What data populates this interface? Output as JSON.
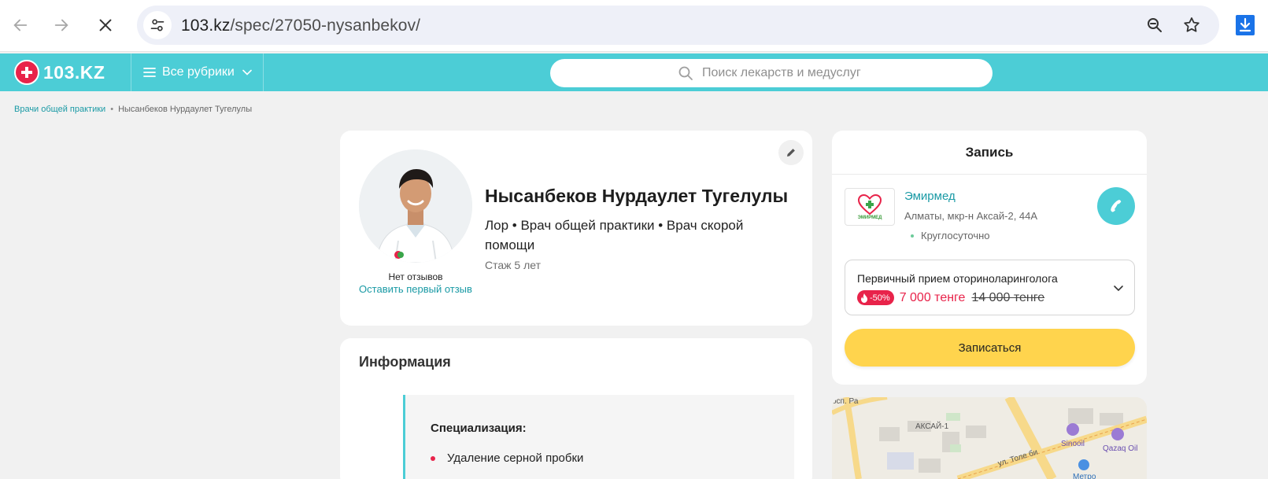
{
  "browser": {
    "url_host": "103.kz",
    "url_path": "/spec/27050-nysanbekov/"
  },
  "site": {
    "logo_text": "103.KZ",
    "rubrics_label": "Все рубрики",
    "search_placeholder": "Поиск лекарств и медуслуг"
  },
  "breadcrumb": {
    "parent": "Врачи общей практики",
    "separator": "•",
    "current": "Нысанбеков Нурдаулет Тугелулы"
  },
  "profile": {
    "name": "Нысанбеков Нурдаулет Тугелулы",
    "specialties": "Лор • Врач общей практики • Врач скорой помощи",
    "experience": "Стаж 5 лет",
    "reviews_none": "Нет отзывов",
    "leave_review": "Оставить первый отзыв"
  },
  "info": {
    "title": "Информация",
    "spec_heading": "Специализация:",
    "spec_items": [
      "Удаление серной пробки"
    ]
  },
  "booking": {
    "title": "Запись",
    "clinic_name": "Эмирмед",
    "clinic_logo_text": "ЭМИРМЕД",
    "clinic_address": "Алматы, мкр-н Аксай-2, 44А",
    "clinic_hours": "Круглосуточно",
    "service_name": "Первичный прием оториноларинголога",
    "discount": "-50%",
    "price_new": "7 000 тенге",
    "price_old": "14 000 тенге",
    "book_button": "Записаться"
  },
  "map": {
    "labels": {
      "district": "АКСАЙ-1",
      "street": "ул. Толе би",
      "street_top": "осп. Ра",
      "poi_1": "Sinooil",
      "poi_2": "Qazaq Oil",
      "metro": "Метро"
    }
  },
  "colors": {
    "brand_teal": "#4ccdd6",
    "brand_red": "#e8234a",
    "button_yellow": "#ffd44d",
    "link": "#1a9aa5"
  }
}
